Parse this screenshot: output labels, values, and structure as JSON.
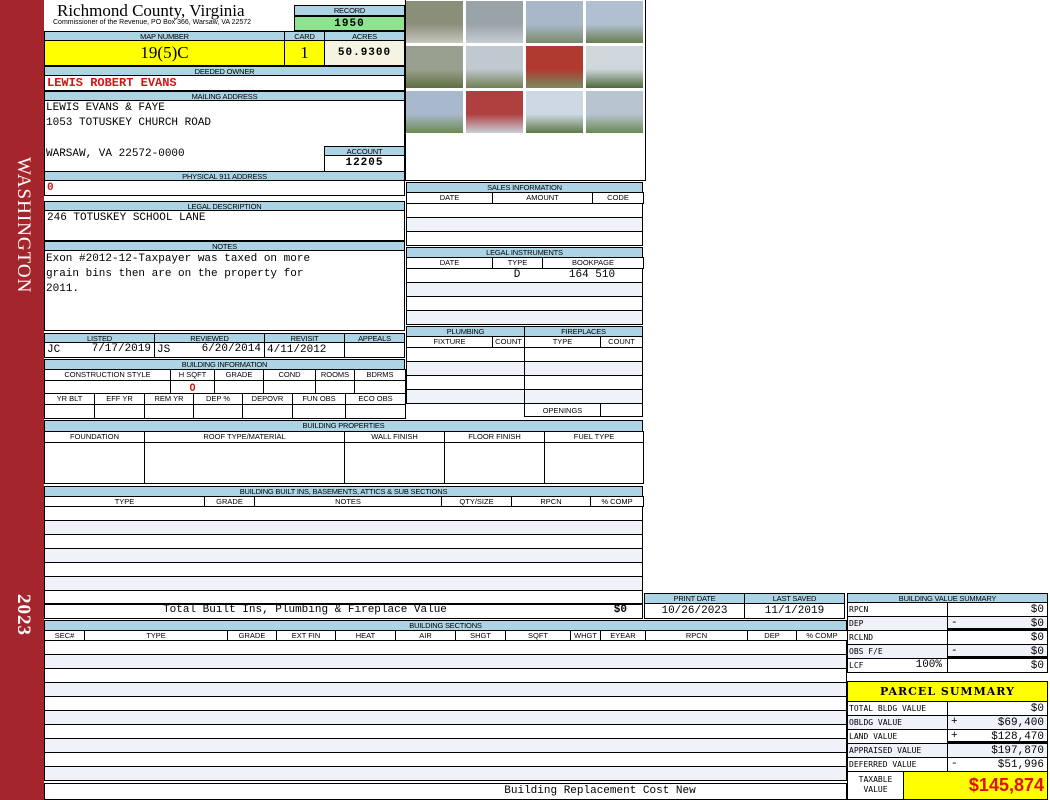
{
  "sidebar": {
    "district": "WASHINGTON",
    "year": "2023"
  },
  "header": {
    "title": "Richmond County, Virginia",
    "subtitle": "Commissioner of the Revenue, PO Box 366, Warsaw, VA 22572",
    "record_label": "RECORD",
    "record": "1950",
    "map_label": "MAP NUMBER",
    "map": "19(5)C",
    "card_label": "CARD",
    "card": "1",
    "acres_label": "ACRES",
    "acres": "50.9300"
  },
  "owner": {
    "label": "DEEDED OWNER",
    "value": "LEWIS ROBERT EVANS"
  },
  "mailing": {
    "label": "MAILING ADDRESS",
    "line1": "LEWIS EVANS & FAYE",
    "line2": "1053 TOTUSKEY CHURCH ROAD",
    "line3": "WARSAW, VA 22572-0000"
  },
  "account": {
    "label": "ACCOUNT",
    "value": "12205"
  },
  "physical": {
    "label": "PHYSICAL 911 ADDRESS",
    "value": "0"
  },
  "legal_desc": {
    "label": "LEGAL DESCRIPTION",
    "value": "246 TOTUSKEY SCHOOL LANE"
  },
  "notes": {
    "label": "NOTES",
    "line1": "Exon #2012-12-Taxpayer was taxed on more",
    "line2": "grain bins then are on the property for",
    "line3": "2011."
  },
  "review": {
    "listed_label": "LISTED",
    "reviewed_label": "REVIEWED",
    "revisit_label": "REVISIT",
    "appeals_label": "APPEALS",
    "listed_by": "JC",
    "listed_date": "7/17/2019",
    "reviewed_by": "JS",
    "reviewed_date": "6/20/2014",
    "revisit": "4/11/2012",
    "appeals": ""
  },
  "building_info": {
    "label": "BUILDING INFORMATION",
    "cols1": [
      "CONSTRUCTION STYLE",
      "H SQFT",
      "GRADE",
      "COND",
      "ROOMS",
      "BDRMS"
    ],
    "hsqft": "0",
    "cols2": [
      "YR BLT",
      "EFF YR",
      "REM YR",
      "DEP %",
      "DEPOVR",
      "FUN OBS",
      "ECO OBS"
    ]
  },
  "sales": {
    "label": "SALES INFORMATION",
    "cols": [
      "DATE",
      "AMOUNT",
      "CODE"
    ]
  },
  "legal_instruments": {
    "label": "LEGAL INSTRUMENTS",
    "cols": [
      "DATE",
      "TYPE",
      "BOOKPAGE"
    ],
    "rows": [
      {
        "date": "",
        "type": "D",
        "bookpage": "164 510"
      }
    ]
  },
  "plumbing": {
    "label": "PLUMBING",
    "cols": [
      "FIXTURE",
      "COUNT"
    ]
  },
  "fireplaces": {
    "label": "FIREPLACES",
    "cols": [
      "TYPE",
      "COUNT"
    ],
    "openings": "OPENINGS"
  },
  "properties": {
    "label": "BUILDING PROPERTIES",
    "cols": [
      "FOUNDATION",
      "ROOF TYPE/MATERIAL",
      "WALL FINISH",
      "FLOOR FINISH",
      "FUEL TYPE"
    ]
  },
  "builtins": {
    "label": "BUILDING BUILT INS, BASEMENTS, ATTICS & SUB SECTIONS",
    "cols": [
      "TYPE",
      "GRADE",
      "NOTES",
      "QTY/SIZE",
      "RPCN",
      "% COMP"
    ],
    "total_label": "Total Built Ins, Plumbing & Fireplace Value",
    "total": "$0"
  },
  "dates": {
    "print_label": "PRINT DATE",
    "print": "10/26/2023",
    "saved_label": "LAST SAVED",
    "saved": "11/1/2019"
  },
  "sections": {
    "label": "BUILDING SECTIONS",
    "cols": [
      "SEC#",
      "TYPE",
      "GRADE",
      "EXT FIN",
      "HEAT",
      "AIR",
      "SHGT",
      "SQFT",
      "WHGT",
      "EYEAR",
      "RPCN",
      "DEP",
      "% COMP"
    ],
    "footer": "Building Replacement Cost New"
  },
  "bvs": {
    "label": "BUILDING VALUE SUMMARY",
    "rows": [
      {
        "label": "RPCN",
        "sign": "",
        "value": "$0"
      },
      {
        "label": "DEP",
        "sign": "-",
        "value": "$0"
      },
      {
        "label": "RCLND",
        "sign": "",
        "value": "$0"
      },
      {
        "label": "OBS F/E",
        "sign": "-",
        "value": "$0"
      },
      {
        "label": "LCF",
        "pct": "100%",
        "sign": "",
        "value": "$0"
      }
    ]
  },
  "parcel": {
    "label": "PARCEL SUMMARY",
    "rows": [
      {
        "label": "TOTAL BLDG VALUE",
        "sign": "",
        "value": "$0"
      },
      {
        "label": "OBLDG VALUE",
        "sign": "+",
        "value": "$69,400"
      },
      {
        "label": "LAND VALUE",
        "sign": "+",
        "value": "$128,470"
      },
      {
        "label": "APPRAISED VALUE",
        "sign": "",
        "value": "$197,870"
      },
      {
        "label": "DEFERRED VALUE",
        "sign": "-",
        "value": "$51,996"
      }
    ],
    "taxable_label": "TAXABLE VALUE",
    "taxable": "$145,874"
  },
  "colors": {
    "sidebar": "#a4262c",
    "header": "#acd4e4",
    "highlight": "#ffff00",
    "record": "#8fe28f",
    "value_red": "#d21414"
  }
}
